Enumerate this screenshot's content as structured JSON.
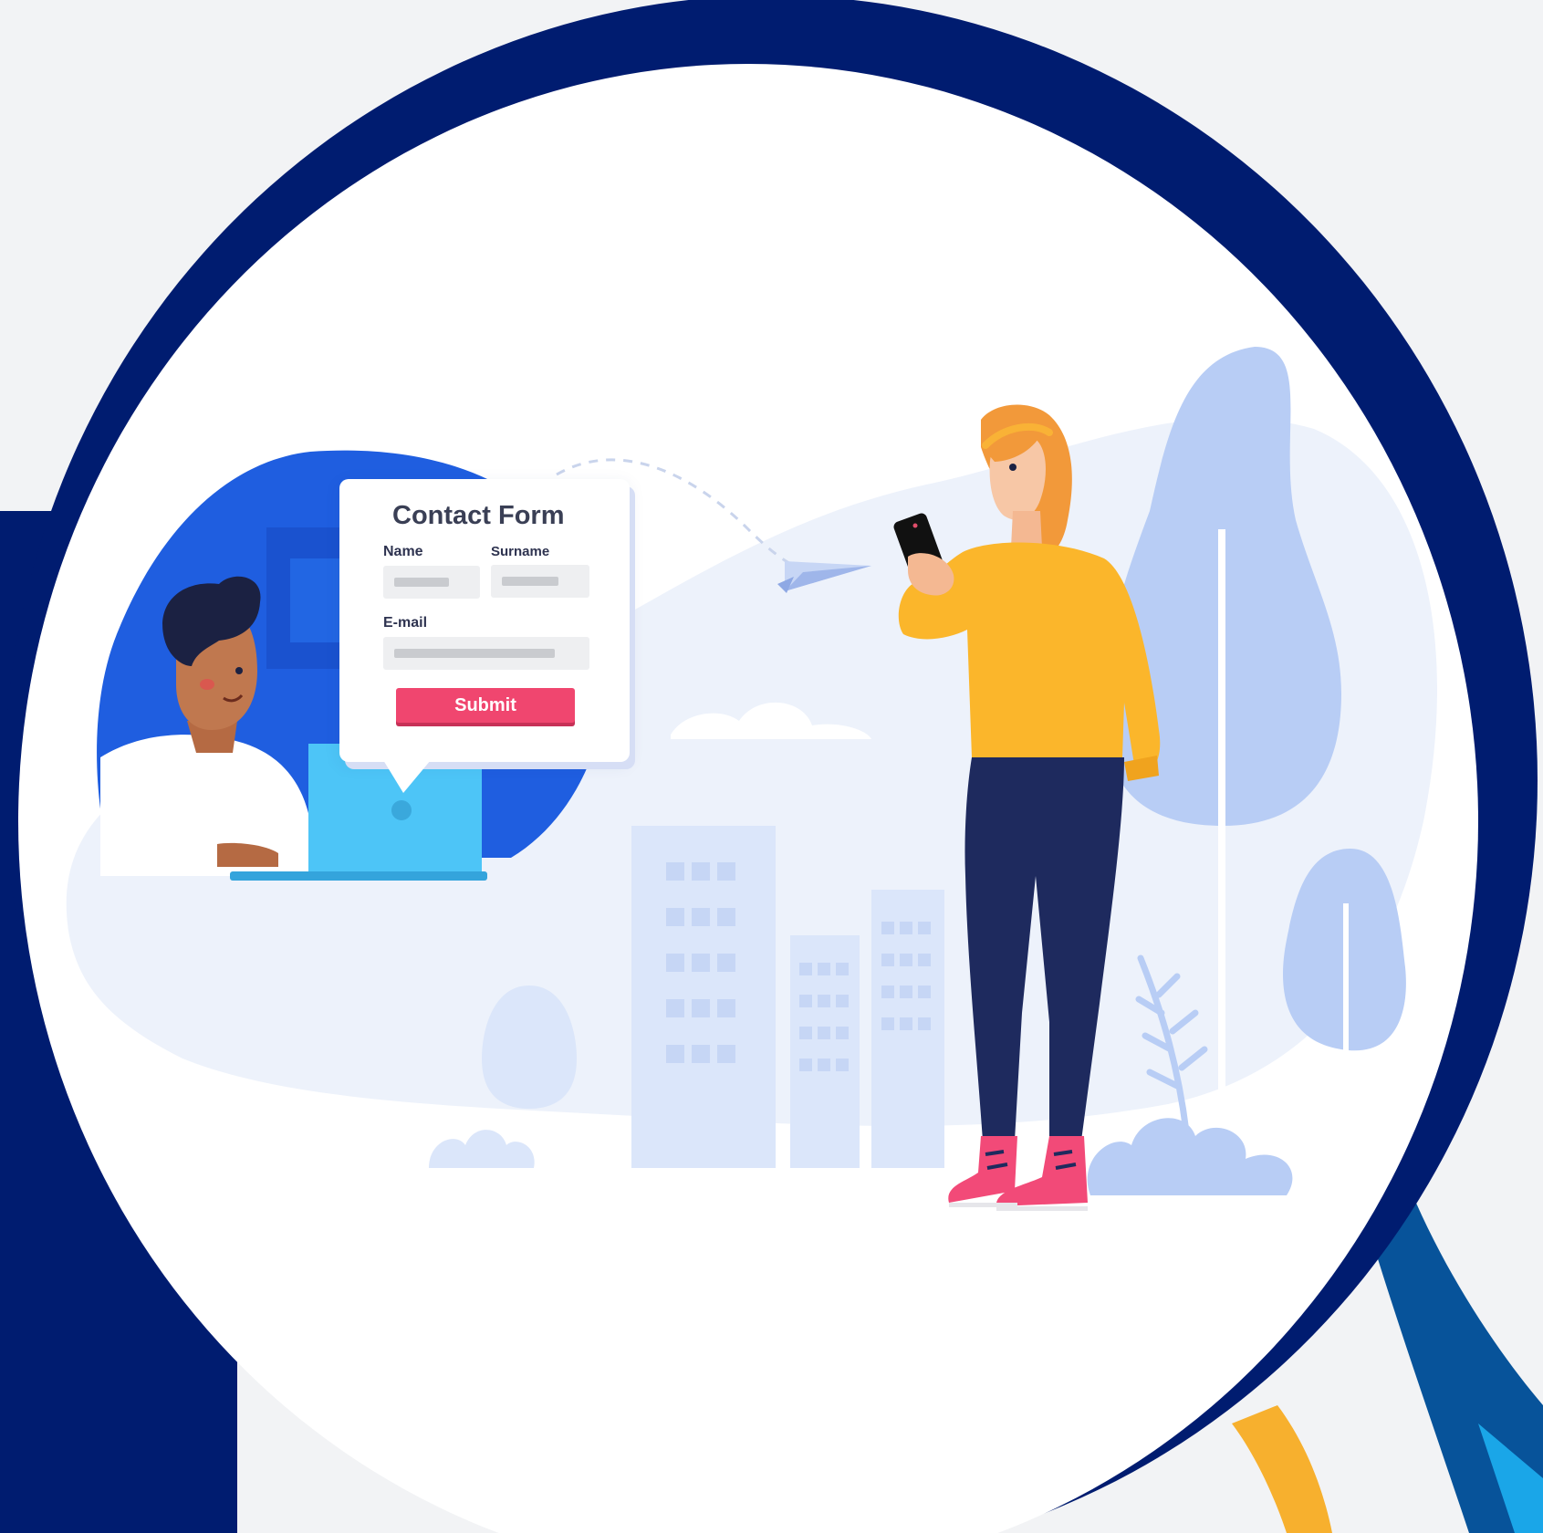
{
  "contact_form": {
    "title": "Contact Form",
    "name_label": "Name",
    "surname_label": "Surname",
    "email_label": "E-mail",
    "submit_label": "Submit"
  },
  "colors": {
    "ring": "#001c70",
    "background": "#f2f3f5",
    "man_backdrop": "#1f5ee0",
    "laptop": "#4dc5f7",
    "submit": "#f0466f",
    "sweater": "#fbb62b",
    "trousers": "#1e2a5e",
    "shoes": "#f24a78",
    "hair": "#f2993a",
    "tree": "#b8cdf5",
    "swoosh_orange": "#f7b02e",
    "swoosh_blue": "#07539a"
  }
}
